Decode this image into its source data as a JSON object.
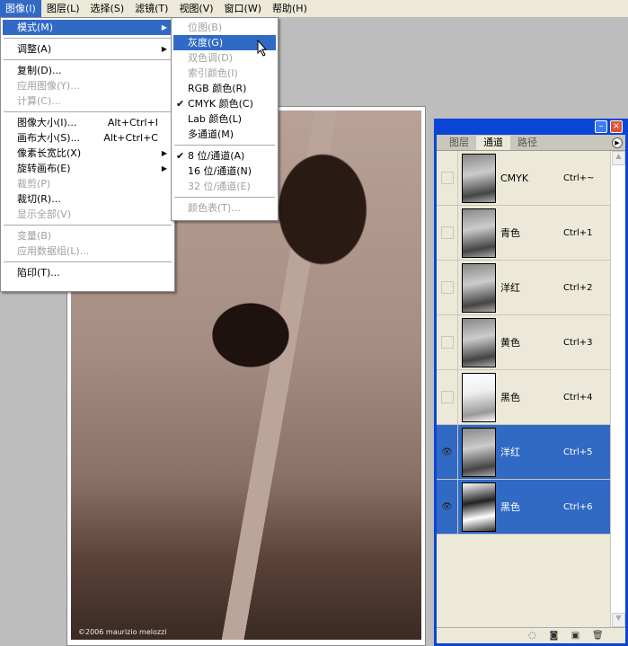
{
  "menubar": {
    "items": [
      "图像(I)",
      "图层(L)",
      "选择(S)",
      "滤镜(T)",
      "视图(V)",
      "窗口(W)",
      "帮助(H)"
    ]
  },
  "image_menu": {
    "items": [
      {
        "label": "模式(M)",
        "submenu": true
      },
      {
        "label": "调整(A)",
        "submenu": true
      },
      {
        "label": "复制(D)..."
      },
      {
        "label": "应用图像(Y)...",
        "disabled": true
      },
      {
        "label": "计算(C)...",
        "disabled": true
      },
      {
        "label": "图像大小(I)...",
        "shortcut": "Alt+Ctrl+I"
      },
      {
        "label": "画布大小(S)...",
        "shortcut": "Alt+Ctrl+C"
      },
      {
        "label": "像素长宽比(X)",
        "submenu": true
      },
      {
        "label": "旋转画布(E)",
        "submenu": true
      },
      {
        "label": "裁剪(P)",
        "disabled": true
      },
      {
        "label": "裁切(R)..."
      },
      {
        "label": "显示全部(V)",
        "disabled": true
      },
      {
        "label": "变量(B)",
        "disabled": true
      },
      {
        "label": "应用数据组(L)...",
        "disabled": true
      },
      {
        "label": "陷印(T)..."
      }
    ]
  },
  "mode_submenu": {
    "items": [
      {
        "label": "位图(B)",
        "disabled": true
      },
      {
        "label": "灰度(G)"
      },
      {
        "label": "双色调(D)",
        "disabled": true
      },
      {
        "label": "索引颜色(I)",
        "disabled": true
      },
      {
        "label": "RGB 颜色(R)"
      },
      {
        "label": "CMYK 颜色(C)",
        "checked": true
      },
      {
        "label": "Lab 颜色(L)"
      },
      {
        "label": "多通道(M)"
      },
      {
        "label": "8 位/通道(A)",
        "checked": true
      },
      {
        "label": "16 位/通道(N)"
      },
      {
        "label": "32 位/通道(E)",
        "disabled": true
      },
      {
        "label": "颜色表(T)...",
        "disabled": true
      }
    ]
  },
  "document": {
    "watermark": "©2006 maurizio melozzi"
  },
  "channels_panel": {
    "tabs": [
      "图层",
      "通道",
      "路径"
    ],
    "active_tab": "通道",
    "channels": [
      {
        "name": "CMYK",
        "shortcut": "Ctrl+~",
        "visible": false,
        "selected": false
      },
      {
        "name": "青色",
        "shortcut": "Ctrl+1",
        "visible": false,
        "selected": false
      },
      {
        "name": "洋红",
        "shortcut": "Ctrl+2",
        "visible": false,
        "selected": false
      },
      {
        "name": "黄色",
        "shortcut": "Ctrl+3",
        "visible": false,
        "selected": false
      },
      {
        "name": "黑色",
        "shortcut": "Ctrl+4",
        "visible": false,
        "selected": false
      },
      {
        "name": "洋红",
        "shortcut": "Ctrl+5",
        "visible": true,
        "selected": true
      },
      {
        "name": "黑色",
        "shortcut": "Ctrl+6",
        "visible": true,
        "selected": true
      }
    ]
  },
  "colors": {
    "highlight": "#316ac5",
    "panel_border": "#0a46d6",
    "menu_bg": "#ece9d8"
  }
}
